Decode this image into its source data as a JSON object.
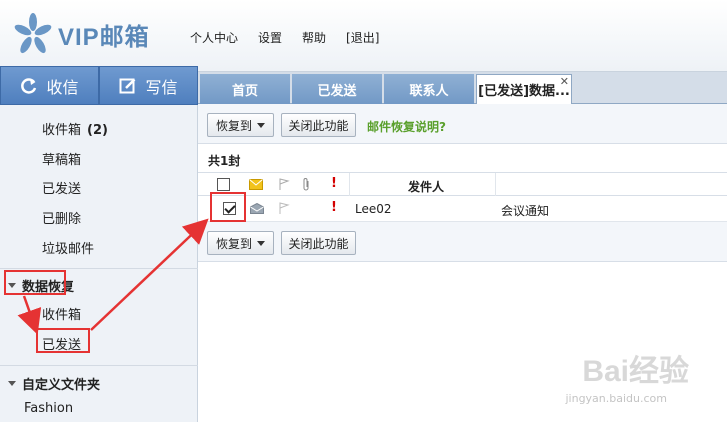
{
  "logo": {
    "text": "VIP邮箱"
  },
  "topnav": [
    "个人中心",
    "设置",
    "帮助",
    "[退出]"
  ],
  "compose": {
    "receive": "收信",
    "write": "写信"
  },
  "sidebar": {
    "inbox": "收件箱",
    "inbox_count": "(2)",
    "drafts": "草稿箱",
    "sent": "已发送",
    "deleted": "已删除",
    "spam": "垃圾邮件",
    "recovery_head": "数据恢复",
    "recovery_inbox": "收件箱",
    "recovery_sent": "已发送",
    "custom_head": "自定义文件夹",
    "custom_item": "Fashion"
  },
  "tabs": [
    "首页",
    "已发送",
    "联系人",
    "[已发送]数据..."
  ],
  "toolbar": {
    "restore_to": "恢复到",
    "close_feature": "关闭此功能",
    "help": "邮件恢复说明?"
  },
  "list": {
    "count": "共1封",
    "col_sender": "发件人",
    "rows": [
      {
        "sender": "Lee02",
        "subject": "会议通知",
        "checked": true
      }
    ]
  },
  "watermark": {
    "main": "Bai经验",
    "sub": "jingyan.baidu.com"
  },
  "colors": {
    "accent": "#5a88b8",
    "annotation": "#e53333",
    "help_link": "#5aa02c"
  }
}
